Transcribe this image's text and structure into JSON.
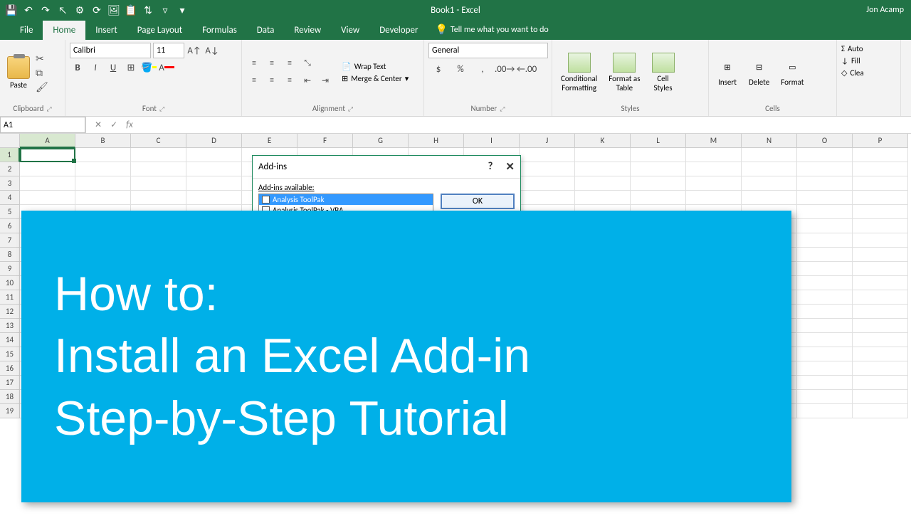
{
  "title": "Book1 - Excel",
  "user": "Jon Acamp",
  "tabs": [
    "File",
    "Home",
    "Insert",
    "Page Layout",
    "Formulas",
    "Data",
    "Review",
    "View",
    "Developer"
  ],
  "active_tab": "Home",
  "tell_me": "Tell me what you want to do",
  "clipboard": {
    "paste": "Paste",
    "title": "Clipboard"
  },
  "font": {
    "name": "Calibri",
    "size": "11",
    "title": "Font"
  },
  "alignment": {
    "wrap": "Wrap Text",
    "merge": "Merge & Center",
    "title": "Alignment"
  },
  "number": {
    "format": "General",
    "title": "Number"
  },
  "styles": {
    "conditional": "Conditional\nFormatting",
    "table": "Format as\nTable",
    "cell": "Cell\nStyles",
    "title": "Styles"
  },
  "cells": {
    "insert": "Insert",
    "delete": "Delete",
    "format": "Format",
    "title": "Cells"
  },
  "editing": {
    "autosum": "Auto",
    "fill": "Fill",
    "clear": "Clea"
  },
  "name_box": "A1",
  "columns": [
    "A",
    "B",
    "C",
    "D",
    "E",
    "F",
    "G",
    "H",
    "I",
    "J",
    "K",
    "L",
    "M",
    "N",
    "O",
    "P"
  ],
  "rows": [
    "1",
    "2",
    "3",
    "4",
    "5",
    "6",
    "7",
    "8",
    "9",
    "10",
    "11",
    "12",
    "13",
    "14",
    "15",
    "16",
    "17",
    "18",
    "19"
  ],
  "dialog": {
    "title": "Add-ins",
    "label": "Add-ins available:",
    "items": [
      "Analysis ToolPak",
      "Analysis ToolPak - VBA"
    ],
    "ok": "OK"
  },
  "banner": {
    "line1": "How to:",
    "line2": "Install an Excel Add-in",
    "line3": "Step-by-Step Tutorial"
  }
}
